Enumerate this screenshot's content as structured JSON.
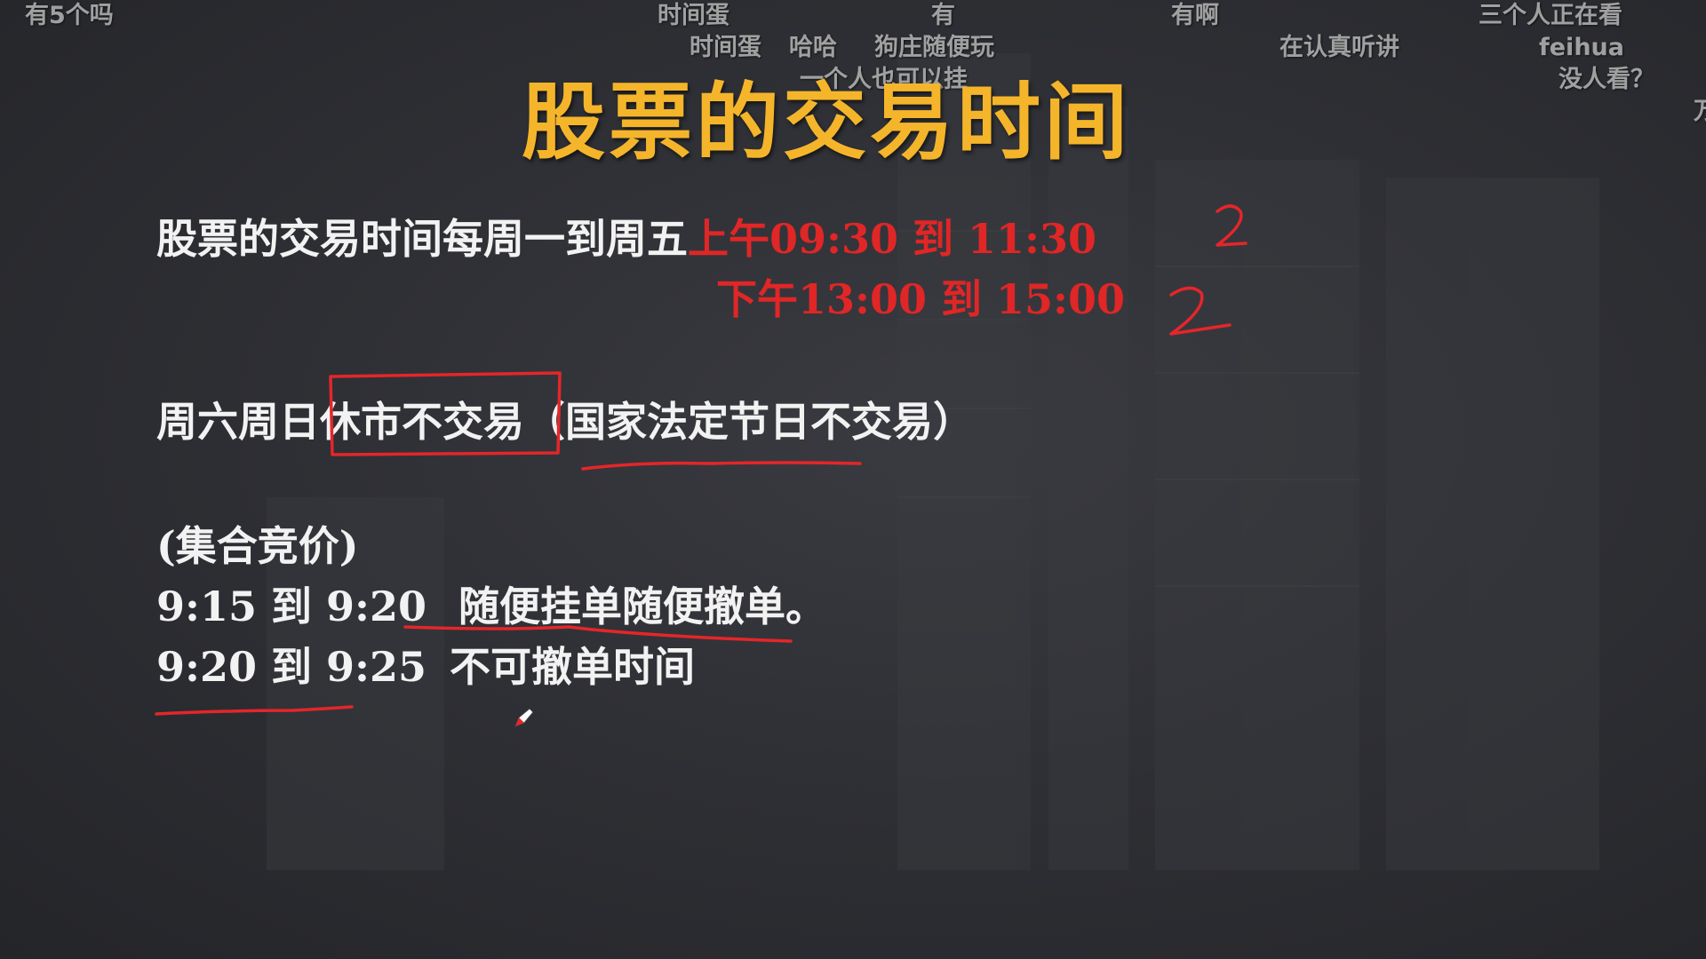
{
  "danmaku": [
    "有5个吗",
    "时间蛋",
    "有",
    "有啊",
    "三个人正在看",
    "时间蛋",
    "哈哈",
    "狗庄随便玩",
    "在认真听讲",
    "feihua",
    "一个人也可以挂",
    "没人看？",
    "万"
  ],
  "slide": {
    "title": "股票的交易时间",
    "line1_black": "股票的交易时间每周一到周五",
    "line1_red": "上午09:30  到 11:30",
    "line2_red": "下午13:00  到 15:00",
    "line3": "周六周日",
    "line3_boxed": "休市不交易",
    "line3_paren": "（国家法定节日不交易）",
    "auction_label": "(集合竞价)",
    "auction_line1_time": "9:15 到 9:20",
    "auction_line1_text": "随便挂单随便撤单。",
    "auction_line2_time": "9:20 到 9:25",
    "auction_line2_text": "不可撤单时间"
  },
  "colors": {
    "title": "#f5b52b",
    "highlight": "#e02626",
    "body_text": "#f2f2f2",
    "annotation_ink": "#e4262a"
  },
  "icons": {
    "cursor": "pen-cursor-icon"
  }
}
